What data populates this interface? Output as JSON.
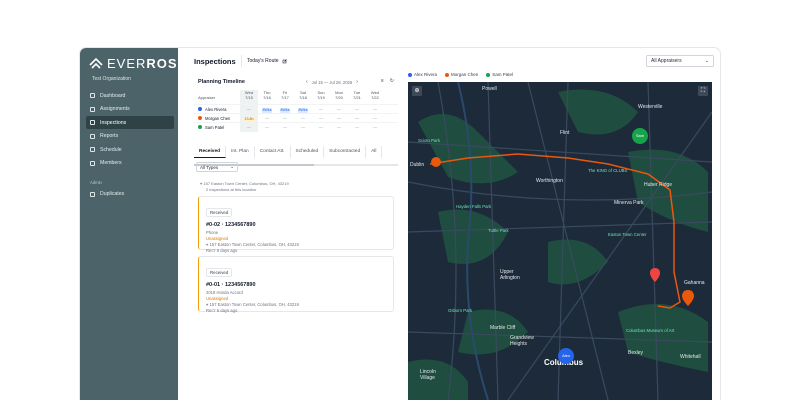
{
  "brand": {
    "name_light": "EVER",
    "name_bold": "ROSE",
    "org": "Test Organization"
  },
  "sidebar": {
    "items": [
      {
        "label": "Dashboard",
        "icon": "dashboard-icon"
      },
      {
        "label": "Assignments",
        "icon": "assignments-icon"
      },
      {
        "label": "Inspections",
        "icon": "inspections-icon",
        "active": true
      },
      {
        "label": "Reports",
        "icon": "reports-icon"
      },
      {
        "label": "Schedule",
        "icon": "calendar-icon"
      },
      {
        "label": "Members",
        "icon": "members-icon"
      }
    ],
    "admin_label": "Admin",
    "admin_items": [
      {
        "label": "Duplicates",
        "icon": "duplicates-icon"
      }
    ]
  },
  "header": {
    "title": "Inspections",
    "route_label": "Today's Route",
    "appraisers_label": "All Appraisers"
  },
  "legend": [
    {
      "name": "Alex Rivera",
      "color": "#2563eb"
    },
    {
      "name": "Morgan Chen",
      "color": "#ea580c"
    },
    {
      "name": "Sam Patel",
      "color": "#16a34a"
    }
  ],
  "timeline": {
    "title": "Planning Timeline",
    "range": "Jul 15 — Jul 28, 2026",
    "appraiser_col": "Appraiser",
    "days": [
      {
        "dow": "Wed",
        "date": "7/15"
      },
      {
        "dow": "Thu",
        "date": "7/16"
      },
      {
        "dow": "Fri",
        "date": "7/17"
      },
      {
        "dow": "Sat",
        "date": "7/18"
      },
      {
        "dow": "Sun",
        "date": "7/19"
      },
      {
        "dow": "Mon",
        "date": "7/20"
      },
      {
        "dow": "Tue",
        "date": "7/21"
      },
      {
        "dow": "Wed",
        "date": "7/22"
      }
    ],
    "rows": [
      {
        "name": "Alex Rivera",
        "color": "#2563eb",
        "cells": [
          "—",
          "8Wks",
          "8Wks",
          "8Wks",
          "—",
          "—",
          "—",
          "—"
        ]
      },
      {
        "name": "Morgan Chen",
        "color": "#ea580c",
        "cells": [
          "13.6h",
          "—",
          "—",
          "—",
          "—",
          "—",
          "—",
          "—"
        ]
      },
      {
        "name": "Sam Patel",
        "color": "#16a34a",
        "cells": [
          "—",
          "—",
          "—",
          "—",
          "—",
          "—",
          "—",
          "—"
        ]
      }
    ]
  },
  "tabs": [
    "Received",
    "Int. Plan",
    "Contact Att.",
    "Scheduled",
    "Subcontracted",
    "All"
  ],
  "filter": {
    "types": "All Types"
  },
  "summary": {
    "address": "157 Easton Town Center, Columbus, OH, 43219",
    "count": "2 inspections at this location"
  },
  "cards": [
    {
      "badge": "Received",
      "id": "#0-02 · 1234567890",
      "sub": "Phone",
      "status": "Unassigned",
      "address": "157 Easton Town Center, Columbus, OH, 43219",
      "due": "Rec'r 6 days ago"
    },
    {
      "badge": "Received",
      "id": "#0-01 · 1234567890",
      "sub": "2018 Honda Accord",
      "status": "Unassigned",
      "address": "157 Easton Town Center, Columbus, OH, 43219",
      "due": "Rec'r 6 days ago"
    }
  ],
  "map": {
    "labels": [
      {
        "text": "Powell"
      },
      {
        "text": "Westerville"
      },
      {
        "text": "Dublin"
      },
      {
        "text": "Worthington"
      },
      {
        "text": "Huber Ridge"
      },
      {
        "text": "Minerva Park"
      },
      {
        "text": "Upper Arlington"
      },
      {
        "text": "Gahanna"
      },
      {
        "text": "Marble Cliff"
      },
      {
        "text": "Grandview Heights"
      },
      {
        "text": "Bexley"
      },
      {
        "text": "Whitehall"
      },
      {
        "text": "Columbus"
      },
      {
        "text": "Lincoln Village"
      },
      {
        "text": "Flint"
      },
      {
        "text": "The KING of CLUBS"
      },
      {
        "text": "Easton Town Center"
      },
      {
        "text": "Scioto Park"
      },
      {
        "text": "Hayden Falls Park"
      },
      {
        "text": "Osborn Park"
      },
      {
        "text": "Tuttle Park"
      },
      {
        "text": "Columbus Museum of Art"
      }
    ],
    "markers": [
      {
        "name": "Alex",
        "color": "#2563eb"
      },
      {
        "name": "Sam",
        "color": "#16a34a"
      }
    ],
    "colors": {
      "route": "#ea580c",
      "land": "#1c2a3a",
      "park": "#1f4d40",
      "road": "#3a4a5e"
    }
  }
}
